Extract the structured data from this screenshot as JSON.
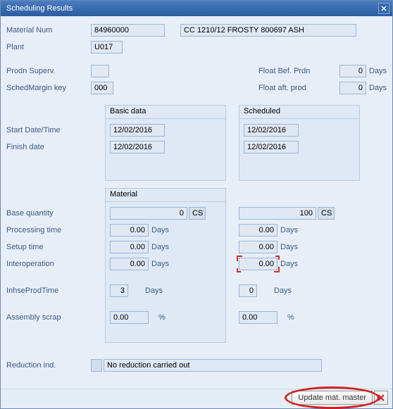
{
  "window": {
    "title": "Scheduling Results"
  },
  "fields": {
    "material_num": {
      "label": "Material Num",
      "value": "84960000"
    },
    "material_desc": {
      "value": "CC 1210/12 FROSTY 800697 ASH"
    },
    "plant": {
      "label": "Plant",
      "value": "U017"
    },
    "prodn_superv": {
      "label": "Prodn Superv.",
      "value": ""
    },
    "sched_margin": {
      "label": "SchedMargin key",
      "value": "000"
    },
    "float_bef": {
      "label": "Float Bef. Prdn",
      "value": "0",
      "unit": "Days"
    },
    "float_aft": {
      "label": "Float aft. prod",
      "value": "0",
      "unit": "Days"
    }
  },
  "sections": {
    "basic_data": "Basic data",
    "scheduled": "Scheduled",
    "material": "Material"
  },
  "dates": {
    "start": {
      "label": "Start Date/Time",
      "basic": "12/02/2016",
      "scheduled": "12/02/2016"
    },
    "finish": {
      "label": "Finish date",
      "basic": "12/02/2016",
      "scheduled": "12/02/2016"
    }
  },
  "material": {
    "base_qty": {
      "label": "Base quantity",
      "basic": "0",
      "scheduled": "100",
      "unit": "CS"
    },
    "processing": {
      "label": "Processing time",
      "basic": "0.00",
      "scheduled": "0.00",
      "unit": "Days"
    },
    "setup": {
      "label": "Setup time",
      "basic": "0.00",
      "scheduled": "0.00",
      "unit": "Days"
    },
    "interop": {
      "label": "Interoperation",
      "basic": "0.00",
      "scheduled": "0.00",
      "unit": "Days"
    },
    "inhse": {
      "label": "InhseProdTime",
      "basic": "3",
      "scheduled": "0",
      "unit": "Days"
    },
    "scrap": {
      "label": "Assembly scrap",
      "basic": "0.00",
      "scheduled": "0.00",
      "unit": "%"
    }
  },
  "reduction": {
    "label": "Reduction ind.",
    "text": "No reduction carried out"
  },
  "footer": {
    "update_label": "Update mat. master"
  }
}
